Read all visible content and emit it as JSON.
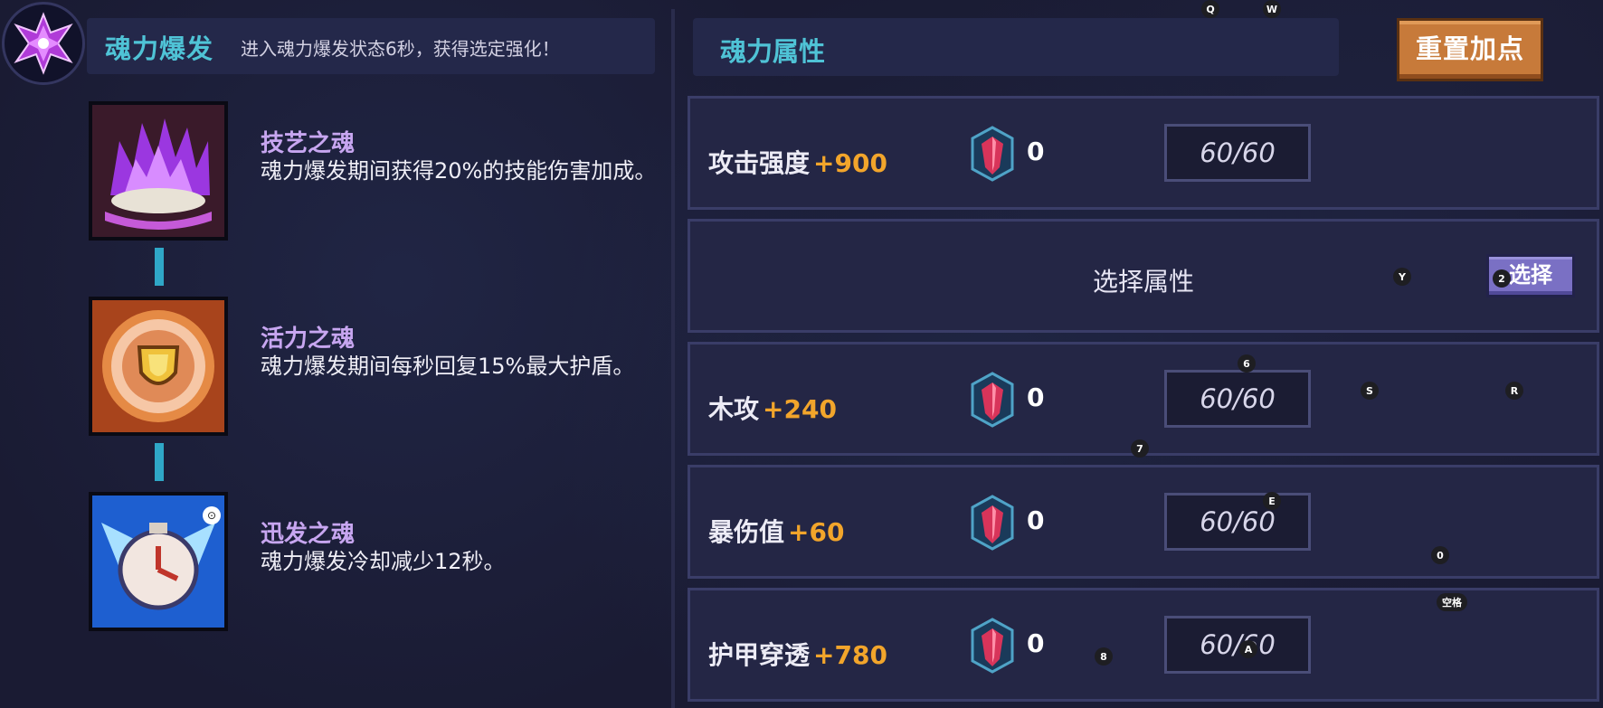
{
  "left_panel": {
    "burst_title": "魂力爆发",
    "burst_desc": "进入魂力爆发状态6秒，获得选定强化！",
    "souls": [
      {
        "name": "技艺之魂",
        "desc": "魂力爆发期间获得20%的技能伤害加成。",
        "icon": "purple-flame-icon"
      },
      {
        "name": "活力之魂",
        "desc": "魂力爆发期间每秒回复15%最大护盾。",
        "icon": "shield-sun-icon"
      },
      {
        "name": "迅发之魂",
        "desc": "魂力爆发冷却减少12秒。",
        "icon": "clock-wings-icon"
      }
    ]
  },
  "right_panel": {
    "title": "魂力属性",
    "reset_label": "重置加点",
    "attributes": [
      {
        "name": "攻击强度",
        "bonus": "+900",
        "count": "0",
        "progress": "60/60"
      },
      {
        "name": "木攻",
        "bonus": "+240",
        "count": "0",
        "progress": "60/60"
      },
      {
        "name": "暴伤值",
        "bonus": "+60",
        "count": "0",
        "progress": "60/60"
      },
      {
        "name": "护甲穿透",
        "bonus": "+780",
        "count": "0",
        "progress": "60/60"
      }
    ],
    "select_row": {
      "label": "选择属性",
      "button": "选择"
    }
  },
  "key_hints": {
    "q": "Q",
    "w": "W",
    "y": "Y",
    "two": "2",
    "six": "6",
    "s": "S",
    "r": "R",
    "seven": "7",
    "e": "E",
    "zero": "0",
    "space": "空格",
    "eight": "8",
    "a": "A"
  },
  "colors": {
    "accent_title": "#4fc3d6",
    "soul_name": "#c7a6f0",
    "bonus": "#f2a52b",
    "reset_button": "#c77a3a",
    "select_button": "#7a70c4"
  }
}
